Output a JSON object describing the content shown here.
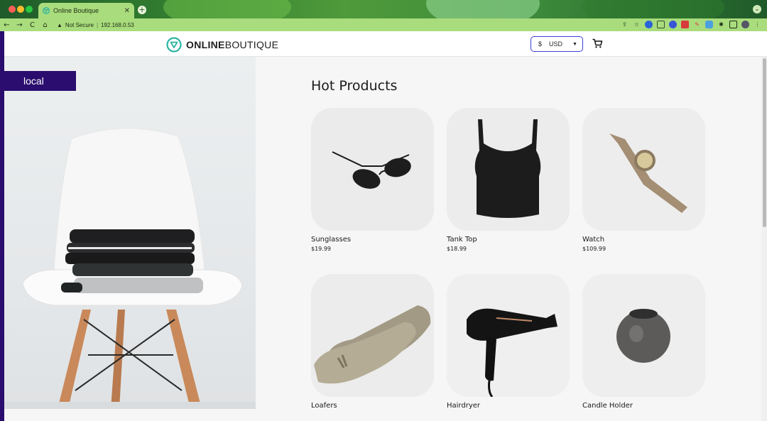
{
  "browser": {
    "tab_title": "Online Boutique",
    "tab_close": "✕",
    "new_tab": "+",
    "profile_chevron": "⌄",
    "nav": {
      "back": "←",
      "forward": "→",
      "reload": "C",
      "home": "⌂"
    },
    "security_warning_icon": "▲",
    "security_label": "Not Secure",
    "url_separator": "|",
    "url": "192.168.0.53",
    "extension_icons": [
      "share-icon",
      "star-icon",
      "extension-icon",
      "extension-icon",
      "extension-icon",
      "extension-icon",
      "extension-icon",
      "extension-icon",
      "puzzle-icon",
      "sidebar-icon",
      "avatar",
      "menu-icon"
    ]
  },
  "header": {
    "logo_bold": "ONLINE",
    "logo_light": "BOUTIQUE",
    "currency_symbol": "$",
    "currency_code": "USD"
  },
  "hero": {
    "env_label": "local"
  },
  "main": {
    "section_title": "Hot Products",
    "products": [
      {
        "name": "Sunglasses",
        "price": "$19.99"
      },
      {
        "name": "Tank Top",
        "price": "$18.99"
      },
      {
        "name": "Watch",
        "price": "$109.99"
      },
      {
        "name": "Loafers",
        "price": ""
      },
      {
        "name": "Hairdryer",
        "price": ""
      },
      {
        "name": "Candle Holder",
        "price": ""
      }
    ]
  },
  "colors": {
    "brand_purple": "#2a0d6e",
    "currency_border": "#3a3ed6",
    "tab_green": "#a9dc7c",
    "logo_teal": "#2bb3a3"
  }
}
